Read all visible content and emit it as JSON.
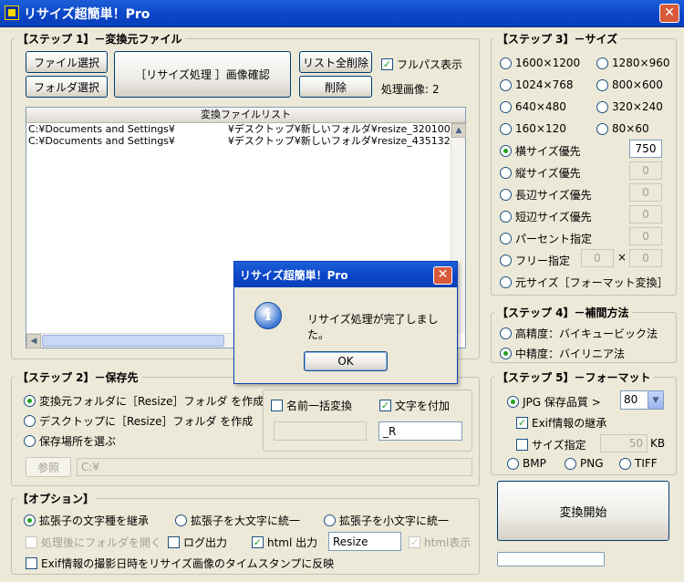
{
  "window": {
    "title": "リサイズ超簡単！Pro",
    "close_glyph": "✕"
  },
  "step1": {
    "title": "【ステップ 1】－変換元ファイル",
    "file_select": "ファイル選択",
    "folder_select": "フォルダ選択",
    "confirm": "［リサイズ処理 ］画像確認",
    "clear_all": "リスト全削除",
    "delete": "削除",
    "fullpath_label": "フルパス表示",
    "processed_label": "処理画像:",
    "processed_count": "2",
    "list_header": "変換ファイルリスト",
    "files": [
      {
        "prefix": "C:¥Documents and Settings¥",
        "suffix": "¥デスクトップ¥新しいフォルダ¥resize_320100"
      },
      {
        "prefix": "C:¥Documents and Settings¥",
        "suffix": "¥デスクトップ¥新しいフォルダ¥resize_435132"
      }
    ]
  },
  "step2": {
    "title": "【ステップ 2】－保存先",
    "opt_source": "変換元フォルダに［Resize］フォルダ を作成",
    "opt_desktop": "デスクトップに［Resize］フォルダ を作成",
    "opt_choose": "保存場所を選ぶ",
    "rename_label": "名前一括変換",
    "append_label": "文字を付加",
    "append_value": "_R",
    "browse": "参照",
    "path": "C:¥"
  },
  "step3": {
    "title": "【ステップ 3】－サイズ",
    "presets": [
      "1600×1200",
      "1280×960",
      "1024×768",
      "800×600",
      "640×480",
      "320×240",
      "160×120",
      "80×60"
    ],
    "width_priority": "横サイズ優先",
    "width_value": "750",
    "height_priority": "縦サイズ優先",
    "height_value": "0",
    "long_side": "長辺サイズ優先",
    "long_value": "0",
    "short_side": "短辺サイズ優先",
    "short_value": "0",
    "percent": "パーセント指定",
    "percent_value": "0",
    "free": "フリー指定",
    "free_w": "0",
    "free_x": "×",
    "free_h": "0",
    "original": "元サイズ［フォーマット変換］"
  },
  "step4": {
    "title": "【ステップ 4】－補間方法",
    "high": "高精度：バイキュービック法",
    "mid": "中精度：バイリニア法"
  },
  "step5": {
    "title": "【ステップ 5】－フォーマット",
    "jpg_label": "JPG 保存品質 >",
    "quality": "80",
    "exif": "Exif情報の継承",
    "size_spec": "サイズ指定",
    "size_value": "50",
    "size_unit": "KB",
    "bmp": "BMP",
    "png": "PNG",
    "tiff": "TIFF"
  },
  "convert_button": "変換開始",
  "options": {
    "title": "【オプション】",
    "keep_case": "拡張子の文字種を継承",
    "upper": "拡張子を大文字に統一",
    "lower": "拡張子を小文字に統一",
    "open_folder": "処理後にフォルダを開く",
    "log": "ログ出力",
    "html": "html 出力",
    "html_name": "Resize",
    "html_view": "html表示",
    "timestamp": "Exif情報の撮影日時をリサイズ画像のタイムスタンプに反映"
  },
  "dialog": {
    "title": "リサイズ超簡単！Pro",
    "message": "リサイズ処理が完了しました。",
    "ok": "OK",
    "icon": "i"
  }
}
